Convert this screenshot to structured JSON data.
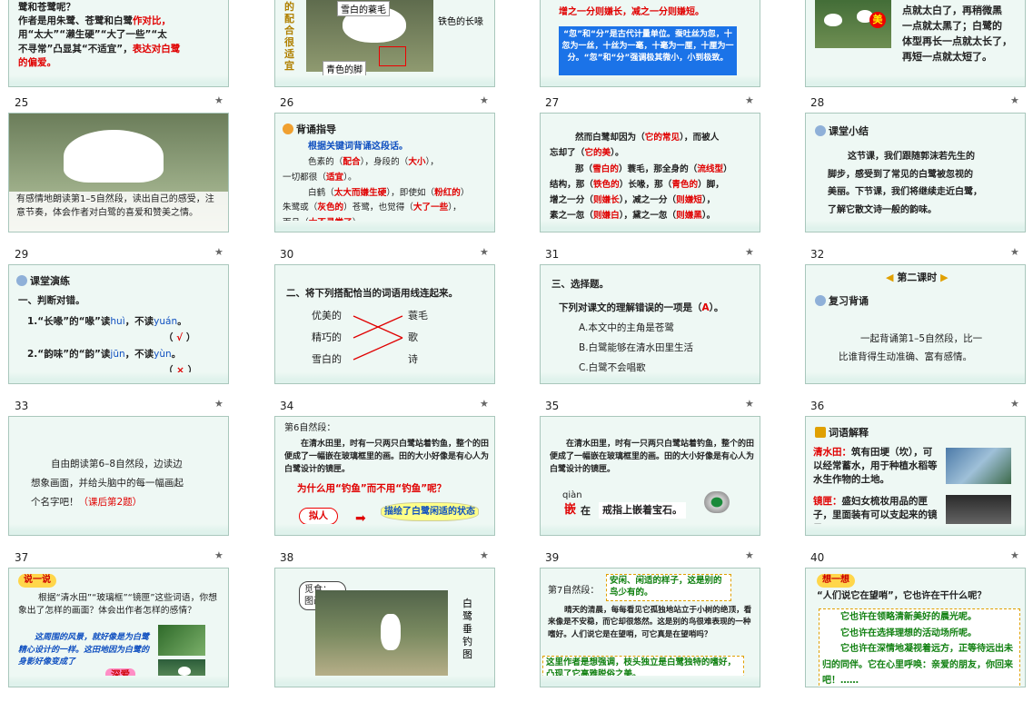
{
  "colors": {
    "red": "#e00000",
    "blue": "#1b73e8",
    "green": "#108010",
    "slide_bg": "#eef8f4"
  },
  "icons": {
    "star": "★",
    "flower": "✿"
  },
  "row0": {
    "s1": {
      "line1": "鹭和苍鹭呢？",
      "line2a": "作者是用朱鹭、苍鹭和白鹭",
      "line2b": "作对比，",
      "line3": "用“太大”“濑生硬”“大了一些”“太",
      "line4a": "不寻常”凸显其“不适宜”，",
      "line4b": "表达对白鹭",
      "line5": "的偏爱。"
    },
    "s2": {
      "side": [
        "的",
        "配",
        "合",
        "很",
        "适",
        "宜"
      ],
      "l1": "雪白的蓑毛",
      "l2": "铁色的长喙",
      "l3": "青色的脚"
    },
    "s3": {
      "top": "增之一分则嫌长，减之一分则嫌短。",
      "box": "“忽”和“分”是古代计量单位。蚕吐丝为忽，十忽为一丝，十丝为一毫，十毫为一厘，十厘为一分。“忽”和“分”强调极其微小，小到极致。"
    },
    "s4": {
      "badge": "美",
      "l1": "点就太白了，再稍微黑",
      "l2": "一点就太黑了；白鹭的",
      "l3": "体型再长一点就太长了，",
      "l4": "再短一点就太短了。"
    }
  },
  "nums": [
    "25",
    "26",
    "27",
    "28",
    "29",
    "30",
    "31",
    "32",
    "33",
    "34",
    "35",
    "36",
    "37",
    "38",
    "39",
    "40"
  ],
  "s25": {
    "text": "有感情地朗读第1–5自然段，读出自己的感受，注意节奏，体会作者对白鹭的喜爱和赞美之情。"
  },
  "s26": {
    "title": "背诵指导",
    "sub": "根据关键词背诵这段话。",
    "l1a": "色素的（",
    "l1b": "配合",
    "l1c": "），身段的（",
    "l1d": "大小",
    "l1e": "），",
    "l2a": "一切都很（",
    "l2b": "适宜",
    "l2c": "）。",
    "l3a": "白鹤（",
    "l3b": "太大而嫌生硬",
    "l3c": "），即使如（",
    "l3d": "粉红的",
    "l3e": "）",
    "l4a": "朱鹭或（",
    "l4b": "灰色的",
    "l4c": "）苍鹭，也觉得（",
    "l4d": "大了一些",
    "l4e": "），",
    "l5a": "而且（",
    "l5b": "太不寻常了",
    "l5c": "）。"
  },
  "s27": {
    "l1a": "然而白鹭却因为（",
    "l1b": "它的常见",
    "l1c": "），而被人",
    "l2a": "忘却了（",
    "l2b": "它的美",
    "l2c": "）。",
    "l3a": "那（",
    "l3b": "雪白的",
    "l3c": "）蓑毛，那全身的（",
    "l3d": "流线型",
    "l3e": "）",
    "l4a": "结构，那（",
    "l4b": "铁色的",
    "l4c": "）长喙，那（",
    "l4d": "青色的",
    "l4e": "）脚，",
    "l5a": "增之一分（",
    "l5b": "则嫌长",
    "l5c": "），减之一分（",
    "l5d": "则嫌短",
    "l5e": "），",
    "l6a": "素之一忽（",
    "l6b": "则嫌白",
    "l6c": "），黛之一忽（",
    "l6d": "则嫌黑",
    "l6e": "）。"
  },
  "s28": {
    "title": "课堂小结",
    "l1": "这节课，我们跟随郭沫若先生的",
    "l2": "脚步，感受到了常见的白鹭被忽视的",
    "l3": "美丽。下节课，我们将继续走近白鹭，",
    "l4": "了解它散文诗一般的韵味。"
  },
  "s29": {
    "title": "课堂演练",
    "sec": "一、判断对错。",
    "q1a": "1.“长喙”的“喙”读",
    "q1b": "huì",
    "q1c": "，不读",
    "q1d": "yuán",
    "q1e": "。",
    "a1": "√",
    "q2a": "2.“韵味”的“韵”读",
    "q2b": "jūn",
    "q2c": "，不读",
    "q2d": "yùn",
    "q2e": "。",
    "a2": "×"
  },
  "s30": {
    "title": "二、将下列搭配恰当的词语用线连起来。",
    "left": [
      "优美的",
      "精巧的",
      "雪白的"
    ],
    "right": [
      "蓑毛",
      "歌",
      "诗"
    ]
  },
  "s31": {
    "title": "三、选择题。",
    "q": "下列对课文的理解错误的一项是（",
    "ans": "A",
    "qend": "）。",
    "a": "A.本文中的主角是苍鹭",
    "bopt": "B.白鹭能够在清水田里生活",
    "c": "C.白鹭不会唱歌"
  },
  "s32": {
    "title": "第二课时",
    "sub": "复习背诵",
    "l1": "一起背诵第1–5自然段，比一",
    "l2": "比谁背得生动准确、富有感情。"
  },
  "s33": {
    "l1": "自由朗读第6–8自然段，边读边",
    "l2": "想象画面，并给头脑中的每一幅画起",
    "l3a": "个名字吧！",
    "l3b": "（课后第2题）"
  },
  "s34": {
    "head": "第6自然段：",
    "p": "在清水田里，时有一只两只白鹭站着钓鱼，整个的田便成了一幅嵌在玻璃框里的画。田的大小好像是有心人为白鹭设计的镜匣。",
    "q": "为什么用“钓鱼”而不用“钓鱼”呢？",
    "tag": "拟人",
    "bub": "描绘了白鹭闲适的状态"
  },
  "s35": {
    "p": "在清水田里，时有一只两只白鹭站着钓鱼，整个的田便成了一幅嵌在玻璃框里的画。田的大小好像是有心人为白鹭设计的镜匣。",
    "py": "qiàn",
    "ch": "嵌",
    "mid": "在",
    "ex": "戒指上嵌着宝石。"
  },
  "s36": {
    "title": "词语解释",
    "w1": "清水田：",
    "d1": "筑有田埂（坎），可以经常蓄水，用于种植水稻等水生作物的土地。",
    "w2": "镜匣：",
    "d2": "盛妇女梳妆用品的匣子，里面装有可以支起来的镜子。"
  },
  "s37": {
    "tag": "说一说",
    "l1": "根据“清水田”“玻璃框”“镜匣”这些词语，你想象出了怎样的画面？体会出作者怎样的感情？",
    "ans": "这周围的风景，就好像是为白鹭精心设计的一样。这田地因为白鹭的身影好像变成了",
    "word": "深爱"
  },
  "s38": {
    "label1": "觅食：",
    "label2": "图画之美",
    "side": [
      "白",
      "鹭",
      "垂",
      "钓",
      "图"
    ]
  },
  "s39": {
    "head": "第7自然段：",
    "bub1": "安闲、闲适的样子，这是别的鸟少有的。",
    "p": "晴天的清晨，每每看见它孤独地站立于小树的绝顶，看来像是不安稳，而它却很悠然。这是别的鸟很难表现的一种嗜好。人们说它是在望哨，可它真是在望哨吗？",
    "bub2": "这里作者是想强调，枝头独立是白鹭独特的嗜好，凸现了它高雅脱俗之美。"
  },
  "s40": {
    "tag": "想一想",
    "q": "“人们说它在望哨”，它也许在干什么呢？",
    "l1": "它也许在领略清新美好的晨光呢。",
    "l2": "它也许在选择理想的活动场所呢。",
    "l3": "它也许在深情地凝视着远方，正等待远出未归的同伴。它在心里呼唤：亲爱的朋友，你回来吧！……"
  }
}
